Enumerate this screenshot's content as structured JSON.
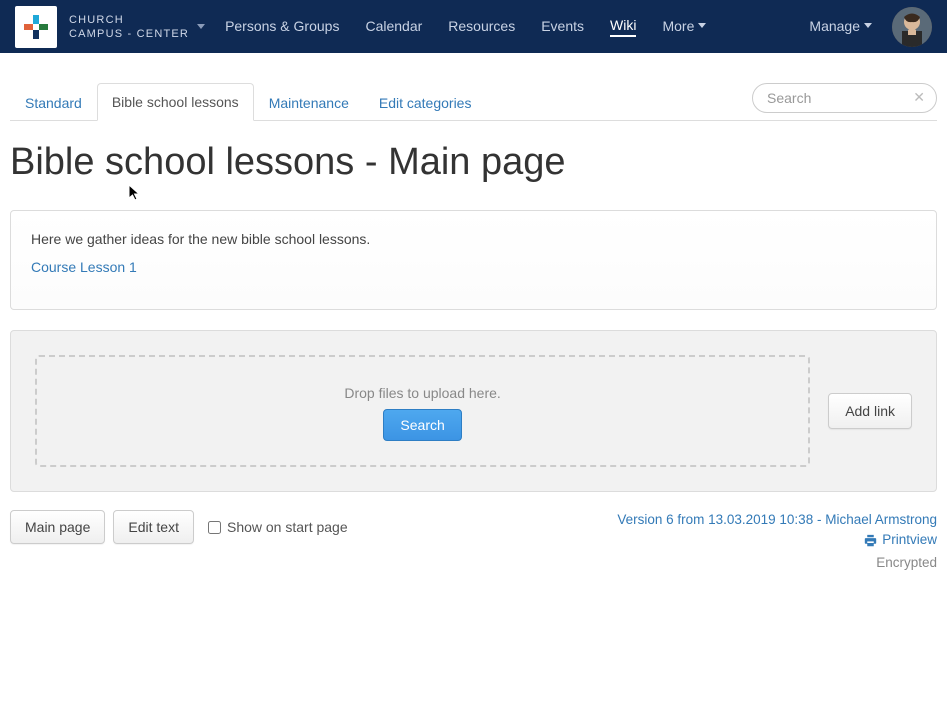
{
  "brand": {
    "line1": "CHURCH",
    "line2": "CAMPUS - CENTER"
  },
  "nav": {
    "persons": "Persons & Groups",
    "calendar": "Calendar",
    "resources": "Resources",
    "events": "Events",
    "wiki": "Wiki",
    "more": "More",
    "manage": "Manage"
  },
  "tabs": {
    "standard": "Standard",
    "bible": "Bible school lessons",
    "maintenance": "Maintenance",
    "editcat": "Edit categories"
  },
  "search": {
    "placeholder": "Search"
  },
  "page": {
    "title": "Bible school lessons - Main page"
  },
  "content": {
    "intro": "Here we gather ideas for the new bible school lessons.",
    "lesson_link": "Course Lesson 1"
  },
  "upload": {
    "drop_label": "Drop files to upload here.",
    "search_btn": "Search",
    "addlink_btn": "Add link"
  },
  "footer": {
    "mainpage_btn": "Main page",
    "edit_btn": "Edit text",
    "show_start": "Show on start page",
    "version": "Version 6 from 13.03.2019 10:38 - Michael Armstrong",
    "printview": "Printview",
    "encrypted": "Encrypted"
  }
}
